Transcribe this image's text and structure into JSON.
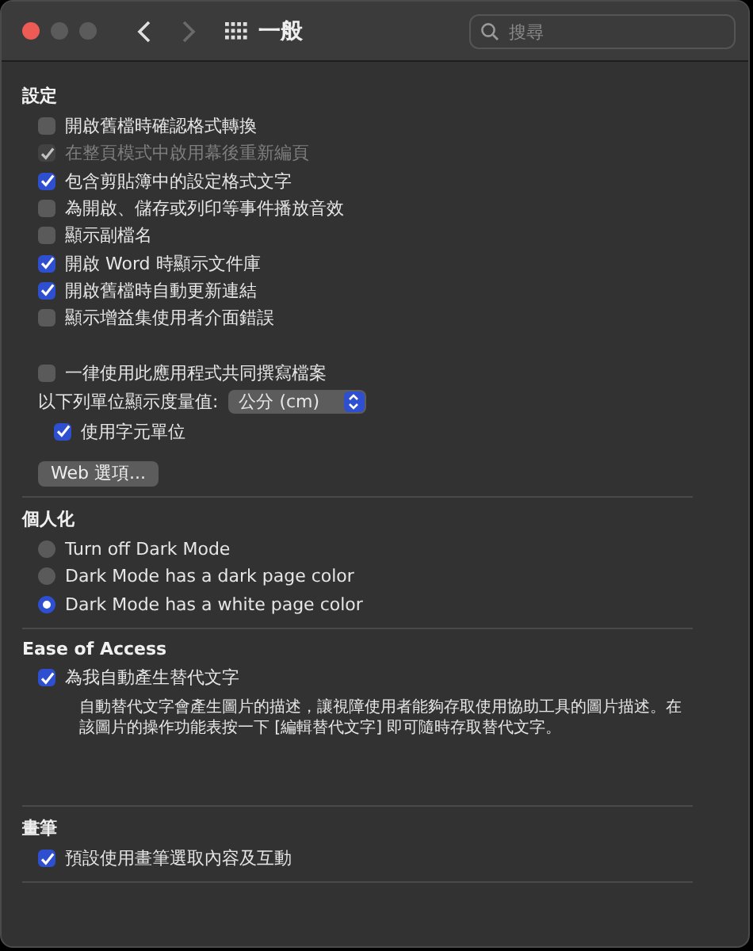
{
  "window": {
    "title": "一般",
    "search": {
      "placeholder": "搜尋"
    },
    "nav": [
      {
        "kind": "back",
        "disabled": false
      },
      {
        "kind": "forward",
        "disabled": true
      }
    ]
  },
  "sections": [
    {
      "title": "設定",
      "items": [
        {
          "kind": "checkbox",
          "label": "開啟舊檔時確認格式轉換",
          "checked": false,
          "disabled": false
        },
        {
          "kind": "checkbox",
          "label": "在整頁模式中啟用幕後重新編頁",
          "checked": true,
          "disabled": true
        },
        {
          "kind": "checkbox",
          "label": "包含剪貼簿中的設定格式文字",
          "checked": true,
          "disabled": false
        },
        {
          "kind": "checkbox",
          "label": "為開啟、儲存或列印等事件播放音效",
          "checked": false,
          "disabled": false
        },
        {
          "kind": "checkbox",
          "label": "顯示副檔名",
          "checked": false,
          "disabled": false
        },
        {
          "kind": "checkbox",
          "label": "開啟 Word 時顯示文件庫",
          "checked": true,
          "disabled": false
        },
        {
          "kind": "checkbox",
          "label": "開啟舊檔時自動更新連結",
          "checked": true,
          "disabled": false
        },
        {
          "kind": "checkbox",
          "label": "顯示增益集使用者介面錯誤",
          "checked": false,
          "disabled": false
        },
        {
          "kind": "checkbox",
          "label": "一律使用此應用程式共同撰寫檔案",
          "checked": false,
          "disabled": false,
          "gap_before": true
        },
        {
          "kind": "select",
          "label": "以下列單位顯示度量值:",
          "value": "公分 (cm)",
          "children": [
            {
              "kind": "checkbox",
              "label": "使用字元單位",
              "checked": true,
              "disabled": false
            }
          ]
        },
        {
          "kind": "button",
          "label": "Web 選項..."
        }
      ]
    },
    {
      "title": "個人化",
      "items": [
        {
          "kind": "radio",
          "label": "Turn off Dark Mode",
          "selected": false
        },
        {
          "kind": "radio",
          "label": "Dark Mode has a dark page color",
          "selected": false
        },
        {
          "kind": "radio",
          "label": "Dark Mode has a white page color",
          "selected": true
        }
      ]
    },
    {
      "title": "Ease of Access",
      "items": [
        {
          "kind": "checkbox",
          "label": "為我自動產生替代文字",
          "checked": true,
          "disabled": false
        },
        {
          "kind": "note",
          "text": "自動替代文字會產生圖片的描述，讓視障使用者能夠存取使用協助工具的圖片描述。在該圖片的操作功能表按一下 [編輯替代文字] 即可隨時存取替代文字。"
        }
      ]
    },
    {
      "title": "畫筆",
      "items": [
        {
          "kind": "checkbox",
          "label": "預設使用畫筆選取內容及互動",
          "checked": true,
          "disabled": false
        }
      ]
    }
  ]
}
